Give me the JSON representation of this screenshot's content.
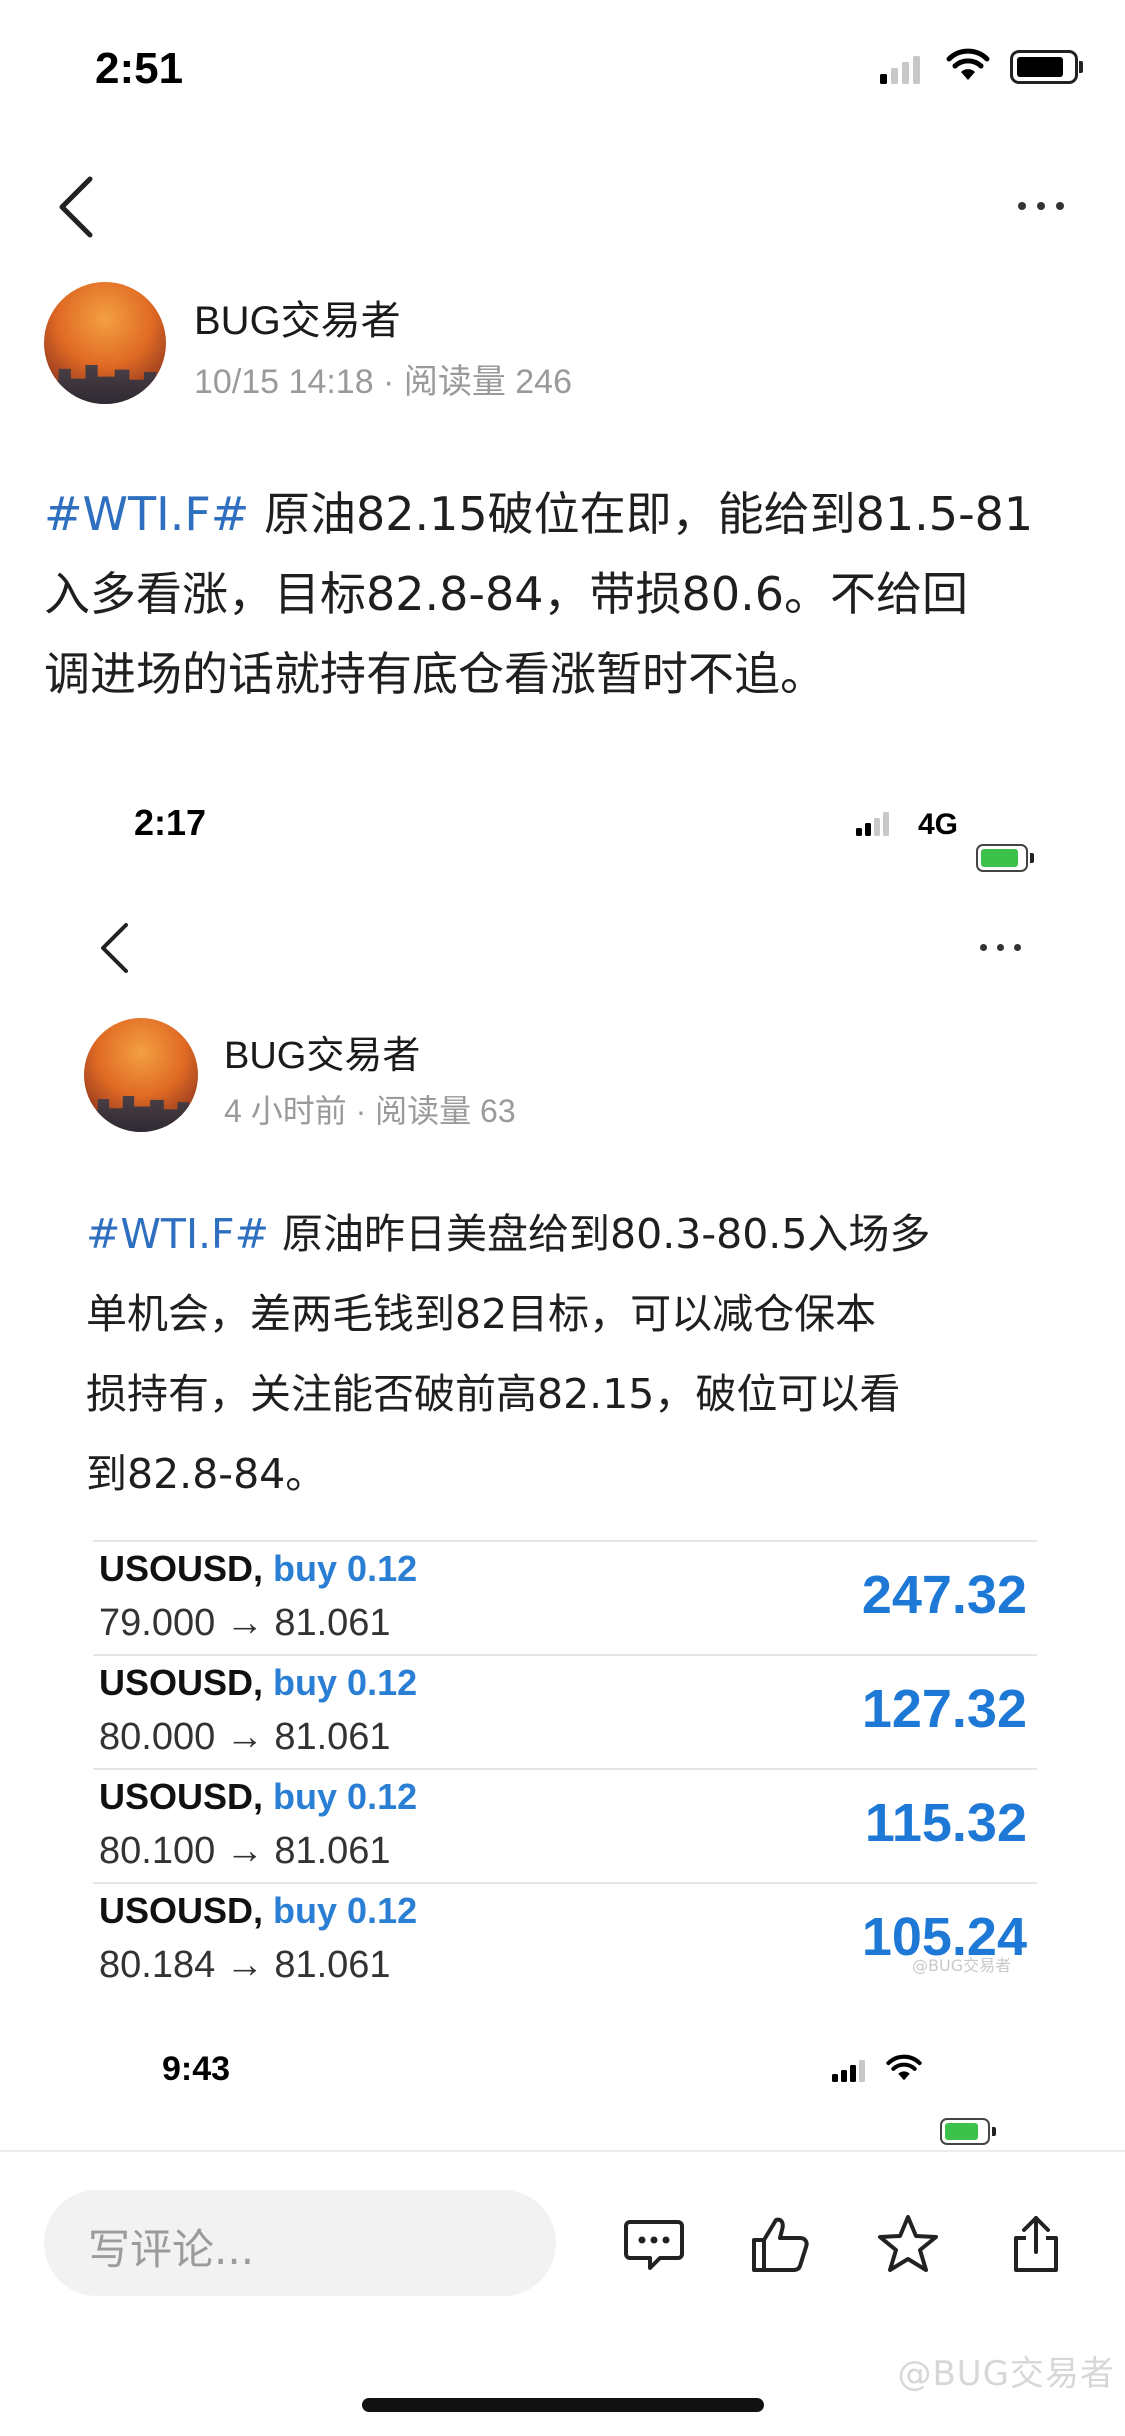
{
  "status_bar_1": {
    "time": "2:51"
  },
  "post1": {
    "author": "BUG交易者",
    "meta": "10/15 14:18 · 阅读量 246",
    "tag": "#WTI.F#",
    "lines": [
      "原油82.15破位在即，能给到81.5-81",
      "入多看涨，目标82.8-84，带损80.6。不给回",
      "调进场的话就持有底仓看涨暂时不追。"
    ]
  },
  "status_bar_2": {
    "time": "2:17",
    "network": "4G"
  },
  "post2": {
    "author": "BUG交易者",
    "meta": "4 小时前 · 阅读量 63",
    "tag": "#WTI.F#",
    "lines": [
      "原油昨日美盘给到80.3-80.5入场多",
      "单机会，差两毛钱到82目标，可以减仓保本",
      "损持有，关注能否破前高82.15，破位可以看",
      "到82.8-84。"
    ]
  },
  "trades": [
    {
      "symbol": "USOUSD,",
      "side": "buy 0.12",
      "range": "79.000 → 81.061",
      "profit": "247.32"
    },
    {
      "symbol": "USOUSD,",
      "side": "buy 0.12",
      "range": "80.000 → 81.061",
      "profit": "127.32"
    },
    {
      "symbol": "USOUSD,",
      "side": "buy 0.12",
      "range": "80.100 → 81.061",
      "profit": "115.32"
    },
    {
      "symbol": "USOUSD,",
      "side": "buy 0.12",
      "range": "80.184 → 81.061",
      "profit": "105.24"
    }
  ],
  "image_watermark": "@BUG交易者",
  "status_bar_3": {
    "time": "9:43"
  },
  "bottom_bar": {
    "comment_placeholder": "写评论...",
    "icons": [
      "comment-icon",
      "like-icon",
      "star-icon",
      "share-icon"
    ]
  },
  "watermark": "@BUG交易者",
  "colors": {
    "tag": "#2f6fbf",
    "profit": "#1e78d6",
    "buy": "#2a7fd4"
  }
}
